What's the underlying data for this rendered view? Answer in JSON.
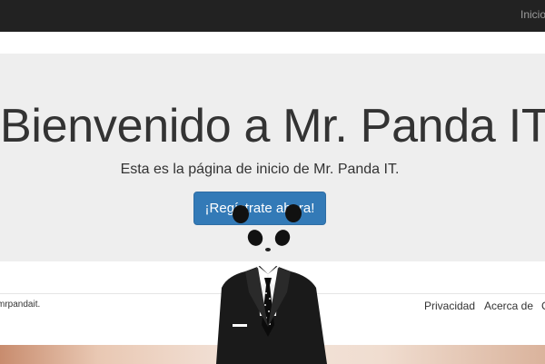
{
  "navbar": {
    "links": [
      {
        "label": "Inicio"
      }
    ]
  },
  "jumbotron": {
    "title": "Bienvenido a Mr. Panda IT",
    "subtitle": "Esta es la página de inicio de Mr. Panda IT.",
    "cta_label": "¡Regístrate ahora!"
  },
  "footer": {
    "copyright": "mrpandait.",
    "links": [
      {
        "label": "Privacidad"
      },
      {
        "label": "Acerca de"
      },
      {
        "label": "C"
      }
    ]
  },
  "mascot": {
    "icon": "panda-in-suit-icon"
  },
  "colors": {
    "navbar_bg": "#222222",
    "jumbotron_bg": "#eeeeee",
    "primary": "#337ab7"
  }
}
